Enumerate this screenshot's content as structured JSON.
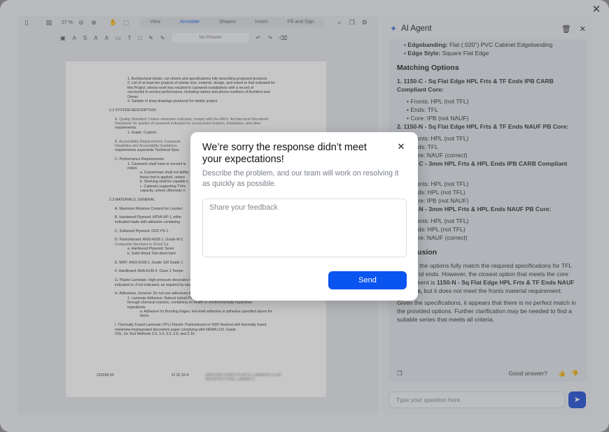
{
  "toolbar": {
    "zoom": "27 %",
    "tabs": [
      "View",
      "Annotate",
      "Shapes",
      "Insert",
      "Fill and Sign"
    ],
    "active_tab": "Annotate",
    "presets": "No Presets"
  },
  "document": {
    "lines": [
      {
        "t": "1.      Architectural binder, cut sheets and specifications fully describing proposed products.",
        "i": 70
      },
      {
        "t": "2.      List of at least ten projects of similar size, material, design, and extent to that indicated for",
        "i": 70
      },
      {
        "t": "        this Project; whose work has resulted in casework installations with a record of",
        "i": 70
      },
      {
        "t": "        successful in-service performance, including names and phone numbers of Architect and",
        "i": 70
      },
      {
        "t": "        Owner.",
        "i": 70
      },
      {
        "t": "3.      Sample of shop drawings produced for similar project.",
        "i": 70
      },
      {
        "t": "",
        "i": 0
      },
      {
        "t": "2.2        SYSTEM DESCRIPTION",
        "i": 44
      },
      {
        "t": "",
        "i": 0
      },
      {
        "t": "A.      Quality Standard:  Unless otherwise indicated, comply with the AWI's 'Architectural Woodwork",
        "i": 52
      },
      {
        "t": "        Standards' for grades of casework indicated for construction finishes, installation, and other",
        "i": 52
      },
      {
        "t": "        requirements.",
        "i": 52
      },
      {
        "t": "1.      Grade: Custom.",
        "i": 70
      },
      {
        "t": "",
        "i": 0
      },
      {
        "t": "B.      Accessibility Requirements:  Casework",
        "i": 52
      },
      {
        "t": "        Disabilities Act Accessibility Guidelines",
        "i": 52
      },
      {
        "t": "        requirements supersede Technical Spec",
        "i": 52
      },
      {
        "t": "",
        "i": 0
      },
      {
        "t": "C.      Performance Requirements",
        "i": 52
      },
      {
        "t": "1.      Casework shall meet or exceed lo",
        "i": 70
      },
      {
        "t": "        noted.",
        "i": 70
      },
      {
        "t": "a.      Countertops shall not deflec",
        "i": 88
      },
      {
        "t": "        linear foot is applied, unless",
        "i": 88
      },
      {
        "t": "b.      Shelving shall be capable o",
        "i": 88
      },
      {
        "t": "c.      Cabinets supporting TV/m",
        "i": 88
      },
      {
        "t": "        capacity, unless otherwise n",
        "i": 88
      },
      {
        "t": "",
        "i": 0
      },
      {
        "t": "2.3        MATERIALS, GENERAL",
        "i": 44
      },
      {
        "t": "",
        "i": 0
      },
      {
        "t": "A.      Maximum Moisture Content for Lumber:",
        "i": 52
      },
      {
        "t": "",
        "i": 0
      },
      {
        "t": "B.      Hardwood Plywood:   HPVA HP-1, eithe",
        "i": 52
      },
      {
        "t": "        indicated made with adhesive containing",
        "i": 52
      },
      {
        "t": "",
        "i": 0
      },
      {
        "t": "C.      Softwood Plywood:  DOC PS 1.",
        "i": 52
      },
      {
        "t": "",
        "i": 0
      },
      {
        "t": "D.      Particleboard:  ANSI A208.1, Grade M-2",
        "i": 52
      },
      {
        "t": "        Composite Members in Wood Ca",
        "i": 52
      },
      {
        "t": "a.      Hardwood Plywood:  Sever",
        "i": 70
      },
      {
        "t": "b.      Solid Wood:  Kiln-dried hard",
        "i": 70
      },
      {
        "t": "",
        "i": 0
      },
      {
        "t": "E.      MDF:  ANSI A208.2, Grade 130 Grade 1",
        "i": 52
      },
      {
        "t": "",
        "i": 0
      },
      {
        "t": "F.      Hardboard:  AHA A135.4, Class 1 Tempe",
        "i": 52
      },
      {
        "t": "",
        "i": 0
      },
      {
        "t": "G.      Plastic Laminate:   High-pressure decorative laminate complying with NEMA LD 3, grades as",
        "i": 52
      },
      {
        "t": "        indicated or, if not indicated, as required by woodwork quality standard.",
        "i": 52
      },
      {
        "t": "",
        "i": 0
      },
      {
        "t": "H.      Adhesives, General:  Do not use adhesives that contain urea formaldehyde.",
        "i": 52
      },
      {
        "t": "1.      Laminate Adhesive:  Natural hybrid PVA; type III water-resistant adhesives that cure",
        "i": 70
      },
      {
        "t": "        through chemical reaction, containing no health or environmentally hazardous",
        "i": 70
      },
      {
        "t": "        ingredients.",
        "i": 70
      },
      {
        "t": "a.      Adhesive for Bonding Edges:  Hot-melt adhesive or adhesive specified above for",
        "i": 88
      },
      {
        "t": "        faces.",
        "i": 88
      },
      {
        "t": "",
        "i": 0
      },
      {
        "t": "I.       Thermally Fused Laminate (TPL) Panels:  Particleboard or MDF finished with thermally fused,",
        "i": 52
      },
      {
        "t": "        melamine-impregnated decorative paper complying with NEMA LD3, Grade",
        "i": 52
      },
      {
        "t": "        VGL, for Test Methods 3.3, 3.4, 3.6, 3.8, and 3.10.",
        "i": 52
      }
    ],
    "footer_left": "222038.00",
    "footer_mid": "12 32 16-4",
    "footer_right": "MANUFACTURED PLASTIC LAMINATE-CLAD ARCHITECTURAL CABINETS"
  },
  "agent": {
    "title": "AI Agent",
    "top_items": [
      {
        "label": "Edgebanding:",
        "value": " Flat (.020\") PVC Cabinet Edgebanding"
      },
      {
        "label": "Edge Style:",
        "value": " Square Flat Edge"
      }
    ],
    "matching_heading": "Matching Options",
    "options": [
      {
        "title": "1. 1150-C - Sq Flat Edge HPL Frts & TF Ends IPB CARB Compliant Core:",
        "items": [
          "Fronts: HPL (not TFL)",
          "Ends: TFL",
          "Core: IPB (not NAUF)"
        ]
      },
      {
        "title": "2. 1150-N - Sq Flat Edge HPL Frts & TF Ends NAUF PB Core:",
        "items": [
          "Fronts: HPL (not TFL)",
          "Ends: TFL",
          "Core: NAUF (correct)"
        ]
      },
      {
        "title": "3. 1300-C - 3mm HPL Frts & HPL Ends IPB CARB Compliant Core:",
        "items": [
          "Fronts: HPL (not TFL)",
          "Ends: HPL (not TFL)",
          "Core: IPB (not NAUF)"
        ]
      },
      {
        "title": "4. 1300-N - 3mm HPL Frts & HPL Ends NAUF PB Core:",
        "items": [
          "Fronts: HPL (not TFL)",
          "Ends: HPL (not TFL)",
          "Core: NAUF (correct)"
        ]
      }
    ],
    "conclusion_heading": "Conclusion",
    "conclusion_text": "None of the options fully match the required specifications for TFL fronts and ends. However, the closest option that meets the core requirement is ",
    "conclusion_bold": "1150-N - Sq Flat Edge HPL Frts & TF Ends NAUF PB Core,",
    "conclusion_tail": " but it does not meet the fronts material requirement.",
    "final_text": "Given the specifications, it appears that there is no perfect match in the provided options. Further clarification may be needed to find a suitable series that meets all criteria.",
    "good_answer": "Good answer?",
    "input_placeholder": "Type your question here"
  },
  "modal": {
    "title": "We’re sorry the response didn’t meet your expectations!",
    "description": "Describe the problem, and our team will work on resolving it as quickly as possible.",
    "placeholder": "Share your feedback",
    "send_label": "Send"
  }
}
